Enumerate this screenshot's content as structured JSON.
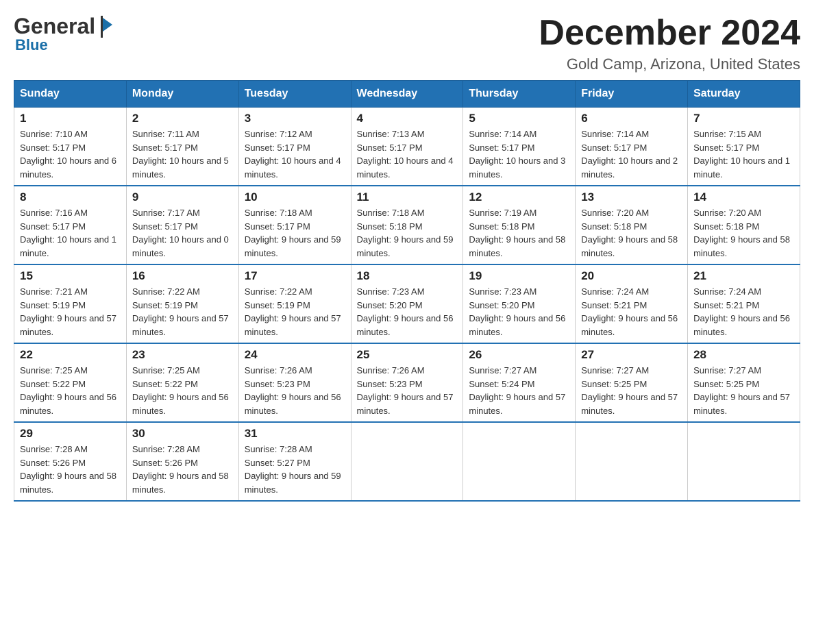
{
  "header": {
    "logo_general": "General",
    "logo_blue": "Blue",
    "main_title": "December 2024",
    "subtitle": "Gold Camp, Arizona, United States"
  },
  "days_of_week": [
    "Sunday",
    "Monday",
    "Tuesday",
    "Wednesday",
    "Thursday",
    "Friday",
    "Saturday"
  ],
  "weeks": [
    [
      {
        "day": "1",
        "sunrise": "7:10 AM",
        "sunset": "5:17 PM",
        "daylight": "10 hours and 6 minutes."
      },
      {
        "day": "2",
        "sunrise": "7:11 AM",
        "sunset": "5:17 PM",
        "daylight": "10 hours and 5 minutes."
      },
      {
        "day": "3",
        "sunrise": "7:12 AM",
        "sunset": "5:17 PM",
        "daylight": "10 hours and 4 minutes."
      },
      {
        "day": "4",
        "sunrise": "7:13 AM",
        "sunset": "5:17 PM",
        "daylight": "10 hours and 4 minutes."
      },
      {
        "day": "5",
        "sunrise": "7:14 AM",
        "sunset": "5:17 PM",
        "daylight": "10 hours and 3 minutes."
      },
      {
        "day": "6",
        "sunrise": "7:14 AM",
        "sunset": "5:17 PM",
        "daylight": "10 hours and 2 minutes."
      },
      {
        "day": "7",
        "sunrise": "7:15 AM",
        "sunset": "5:17 PM",
        "daylight": "10 hours and 1 minute."
      }
    ],
    [
      {
        "day": "8",
        "sunrise": "7:16 AM",
        "sunset": "5:17 PM",
        "daylight": "10 hours and 1 minute."
      },
      {
        "day": "9",
        "sunrise": "7:17 AM",
        "sunset": "5:17 PM",
        "daylight": "10 hours and 0 minutes."
      },
      {
        "day": "10",
        "sunrise": "7:18 AM",
        "sunset": "5:17 PM",
        "daylight": "9 hours and 59 minutes."
      },
      {
        "day": "11",
        "sunrise": "7:18 AM",
        "sunset": "5:18 PM",
        "daylight": "9 hours and 59 minutes."
      },
      {
        "day": "12",
        "sunrise": "7:19 AM",
        "sunset": "5:18 PM",
        "daylight": "9 hours and 58 minutes."
      },
      {
        "day": "13",
        "sunrise": "7:20 AM",
        "sunset": "5:18 PM",
        "daylight": "9 hours and 58 minutes."
      },
      {
        "day": "14",
        "sunrise": "7:20 AM",
        "sunset": "5:18 PM",
        "daylight": "9 hours and 58 minutes."
      }
    ],
    [
      {
        "day": "15",
        "sunrise": "7:21 AM",
        "sunset": "5:19 PM",
        "daylight": "9 hours and 57 minutes."
      },
      {
        "day": "16",
        "sunrise": "7:22 AM",
        "sunset": "5:19 PM",
        "daylight": "9 hours and 57 minutes."
      },
      {
        "day": "17",
        "sunrise": "7:22 AM",
        "sunset": "5:19 PM",
        "daylight": "9 hours and 57 minutes."
      },
      {
        "day": "18",
        "sunrise": "7:23 AM",
        "sunset": "5:20 PM",
        "daylight": "9 hours and 56 minutes."
      },
      {
        "day": "19",
        "sunrise": "7:23 AM",
        "sunset": "5:20 PM",
        "daylight": "9 hours and 56 minutes."
      },
      {
        "day": "20",
        "sunrise": "7:24 AM",
        "sunset": "5:21 PM",
        "daylight": "9 hours and 56 minutes."
      },
      {
        "day": "21",
        "sunrise": "7:24 AM",
        "sunset": "5:21 PM",
        "daylight": "9 hours and 56 minutes."
      }
    ],
    [
      {
        "day": "22",
        "sunrise": "7:25 AM",
        "sunset": "5:22 PM",
        "daylight": "9 hours and 56 minutes."
      },
      {
        "day": "23",
        "sunrise": "7:25 AM",
        "sunset": "5:22 PM",
        "daylight": "9 hours and 56 minutes."
      },
      {
        "day": "24",
        "sunrise": "7:26 AM",
        "sunset": "5:23 PM",
        "daylight": "9 hours and 56 minutes."
      },
      {
        "day": "25",
        "sunrise": "7:26 AM",
        "sunset": "5:23 PM",
        "daylight": "9 hours and 57 minutes."
      },
      {
        "day": "26",
        "sunrise": "7:27 AM",
        "sunset": "5:24 PM",
        "daylight": "9 hours and 57 minutes."
      },
      {
        "day": "27",
        "sunrise": "7:27 AM",
        "sunset": "5:25 PM",
        "daylight": "9 hours and 57 minutes."
      },
      {
        "day": "28",
        "sunrise": "7:27 AM",
        "sunset": "5:25 PM",
        "daylight": "9 hours and 57 minutes."
      }
    ],
    [
      {
        "day": "29",
        "sunrise": "7:28 AM",
        "sunset": "5:26 PM",
        "daylight": "9 hours and 58 minutes."
      },
      {
        "day": "30",
        "sunrise": "7:28 AM",
        "sunset": "5:26 PM",
        "daylight": "9 hours and 58 minutes."
      },
      {
        "day": "31",
        "sunrise": "7:28 AM",
        "sunset": "5:27 PM",
        "daylight": "9 hours and 59 minutes."
      },
      null,
      null,
      null,
      null
    ]
  ]
}
